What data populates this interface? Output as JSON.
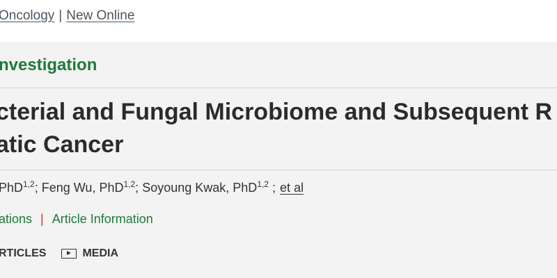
{
  "breadcrumb": {
    "journal": "Oncology",
    "section": "New Online",
    "separator": "|"
  },
  "article": {
    "type": "nvestigation",
    "title_line1": "cterial and Fungal Microbiome and Subsequent R",
    "title_line2": "atic Cancer",
    "authors": [
      {
        "name_prefix": "PhD",
        "sup": "1,2",
        "sep": ";"
      },
      {
        "name_prefix": "Feng Wu, PhD",
        "sup": "1,2",
        "sep": ";"
      },
      {
        "name_prefix": "Soyoung Kwak, PhD",
        "sup": "1,2",
        "sep": ";"
      }
    ],
    "et_al": "et al"
  },
  "links": {
    "affiliations": "ations",
    "separator": "|",
    "article_information": "Article Information"
  },
  "tabs": {
    "related": "RTICLES",
    "media": "MEDIA"
  },
  "colors": {
    "accent_green": "#1f7a3c",
    "separator_red": "#c0392b",
    "background_gray": "#f3f3f3"
  }
}
